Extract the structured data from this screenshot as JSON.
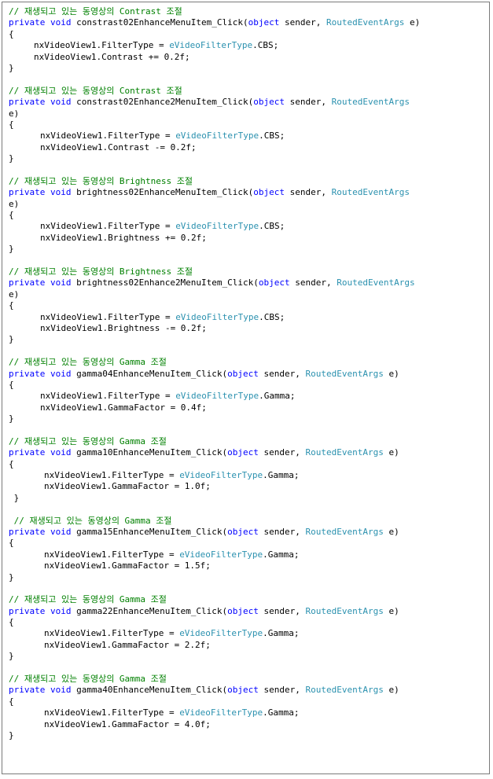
{
  "keywords": {
    "private": "private",
    "void": "void",
    "object": "object"
  },
  "types": {
    "event_args": "RoutedEventArgs",
    "filter_enum": "eVideoFilterType"
  },
  "blocks": [
    {
      "comment": "// 재생되고 있는 동영상의 Contrast 조절",
      "method": "constrast02EnhanceMenuItem_Click(",
      "param1": "sender,",
      "param2": "e)",
      "open": "{",
      "line1_pre": "nxVideoView1.FilterType = ",
      "line1_post": ".CBS;",
      "line2": "nxVideoView1.Contrast += 0.2f;",
      "close": "}"
    },
    {
      "comment": "// 재생되고 있는 동영상의 Contrast 조절",
      "method": "constrast02Enhance2MenuItem_Click(",
      "param1": "sender,",
      "param2": "e)",
      "open": "{",
      "line1_pre": "nxVideoView1.FilterType = ",
      "line1_post": ".CBS;",
      "line2": "nxVideoView1.Contrast -= 0.2f;",
      "close": "}"
    },
    {
      "comment": "// 재생되고 있는 동영상의 Brightness 조절",
      "method": "brightness02EnhanceMenuItem_Click(",
      "param1": "sender,",
      "param2": "e)",
      "open": "{",
      "line1_pre": "nxVideoView1.FilterType = ",
      "line1_post": ".CBS;",
      "line2": "nxVideoView1.Brightness += 0.2f;",
      "close": "}"
    },
    {
      "comment": "// 재생되고 있는 동영상의 Brightness 조절",
      "method": "brightness02Enhance2MenuItem_Click(",
      "param1": "sender,",
      "param2": "e)",
      "open": "{",
      "line1_pre": "nxVideoView1.FilterType = ",
      "line1_post": ".CBS;",
      "line2": "nxVideoView1.Brightness -= 0.2f;",
      "close": "}"
    },
    {
      "comment": "// 재생되고 있는 동영상의 Gamma 조절",
      "method": "gamma04EnhanceMenuItem_Click(",
      "param1": "sender,",
      "param2": "e)",
      "open": "{",
      "line1_pre": "nxVideoView1.FilterType = ",
      "line1_post": ".Gamma;",
      "line2": "nxVideoView1.GammaFactor = 0.4f;",
      "close": "}"
    },
    {
      "comment": "// 재생되고 있는 동영상의 Gamma 조절",
      "method": "gamma10EnhanceMenuItem_Click(",
      "param1": "sender,",
      "param2": "e)",
      "open": "{",
      "line1_pre": "nxVideoView1.FilterType = ",
      "line1_post": ".Gamma;",
      "line2": "nxVideoView1.GammaFactor = 1.0f;",
      "close": " }"
    },
    {
      "comment": " // 재생되고 있는 동영상의 Gamma 조절",
      "method": "gamma15EnhanceMenuItem_Click(",
      "param1": "sender,",
      "param2": "e)",
      "open": "{",
      "line1_pre": "nxVideoView1.FilterType = ",
      "line1_post": ".Gamma;",
      "line2": "nxVideoView1.GammaFactor = 1.5f;",
      "close": "}"
    },
    {
      "comment": "// 재생되고 있는 동영상의 Gamma 조절",
      "method": "gamma22EnhanceMenuItem_Click(",
      "param1": "sender,",
      "param2": "e)",
      "open": "{",
      "line1_pre": "nxVideoView1.FilterType = ",
      "line1_post": ".Gamma;",
      "line2": "nxVideoView1.GammaFactor = 2.2f;",
      "close": "}"
    },
    {
      "comment": "// 재생되고 있는 동영상의 Gamma 조절",
      "method": "gamma40EnhanceMenuItem_Click(",
      "param1": "sender,",
      "param2": "e)",
      "open": "{",
      "line1_pre": "nxVideoView1.FilterType = ",
      "line1_post": ".Gamma;",
      "line2": "nxVideoView1.GammaFactor = 4.0f;",
      "close": "}"
    }
  ]
}
